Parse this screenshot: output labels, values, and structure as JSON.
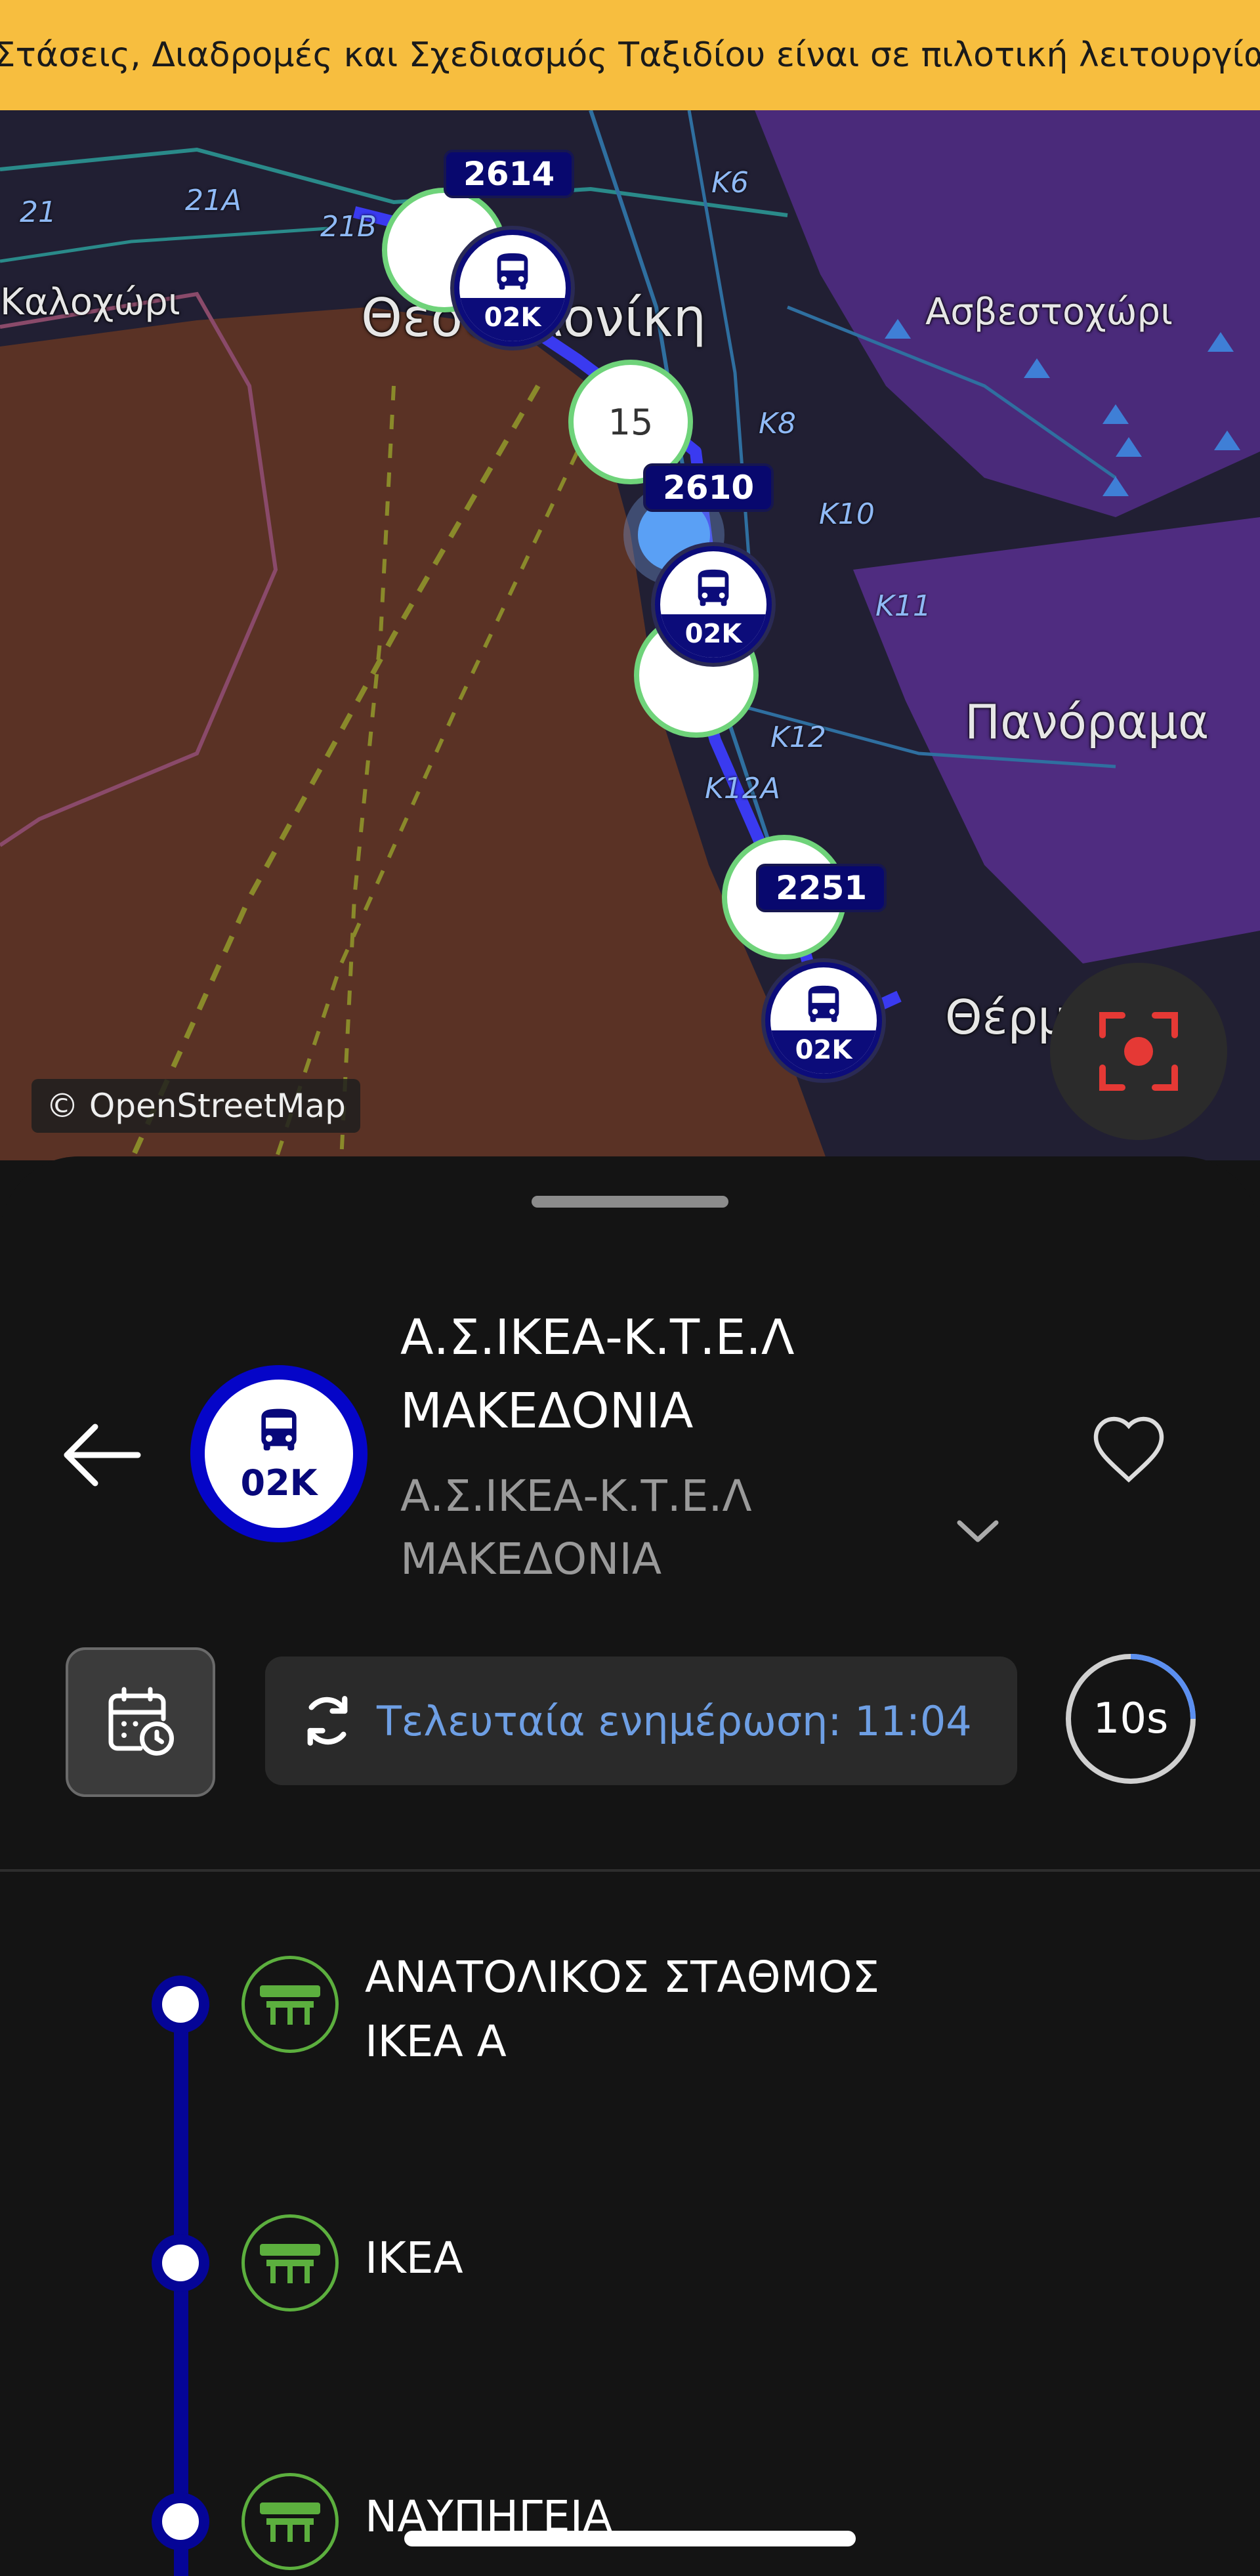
{
  "banner": {
    "text": "Στάσεις, Διαδρομές και Σχεδιασμός Ταξιδίου είναι σε πιλοτική λειτουργία",
    "color": "#F7BE3F"
  },
  "map": {
    "places": {
      "kalochori": "Καλοχώρι",
      "thessaloniki": "Θεσσαλονίκη",
      "asvestochori": "Ασβεστοχώρι",
      "panorama": "Πανόραμα",
      "thermi": "Θέρμη"
    },
    "roads": {
      "r21": "21",
      "r21a": "21A",
      "r21b": "21B",
      "k6": "K6",
      "k8": "K8",
      "k10": "K10",
      "k11": "K11",
      "k12": "K12",
      "k12a": "K12A"
    },
    "cluster_count": "15",
    "vehicles": [
      {
        "id": "2614",
        "route": "02K"
      },
      {
        "id": "2610",
        "route": "02K"
      },
      {
        "id": "2251",
        "route": "02K"
      }
    ],
    "attribution": "© OpenStreetMap",
    "locate_icon": "target-icon"
  },
  "route": {
    "code": "02K",
    "title": "Α.Σ.ΙΚΕΑ-Κ.Τ.Ε.Λ ΜΑΚΕΔΟΝΙΑ",
    "subtitle": "Α.Σ.ΙΚΕΑ-Κ.Τ.Ε.Λ ΜΑΚΕΔΟΝΙΑ",
    "color": "#0505c8"
  },
  "status": {
    "last_update": "Τελευταία ενημέρωση: 11:04",
    "timer": "10s",
    "timer_progress": 0.25
  },
  "stops": [
    {
      "name": "ΑΝΑΤΟΛΙΚΟΣ ΣΤΑΘΜΟΣ ΙΚΕΑ Α"
    },
    {
      "name": "ΙΚΕΑ"
    },
    {
      "name": "ΝΑΥΠΗΓΕΙΑ"
    }
  ],
  "icons": {
    "back": "arrow-left-icon",
    "favorite": "heart-icon",
    "expand": "chevron-down-icon",
    "schedule": "calendar-clock-icon",
    "refresh": "refresh-icon",
    "stop": "bus-stop-icon",
    "bus": "bus-icon"
  }
}
